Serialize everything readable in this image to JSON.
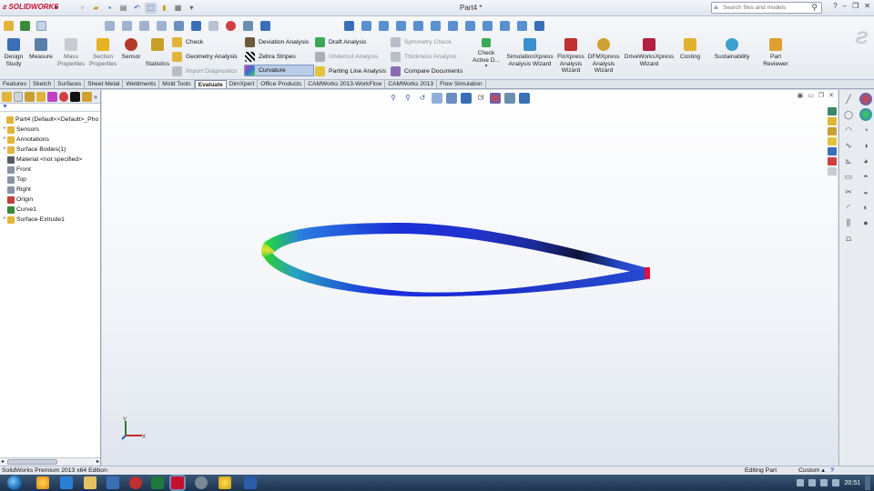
{
  "app": {
    "logo": "SOLIDWORKS",
    "document_title": "Part4 *"
  },
  "search": {
    "placeholder": "Search files and models"
  },
  "evaluate_toolbar": {
    "big_buttons": [
      {
        "label": "Design Study",
        "icon": "design-study-icon",
        "color": "#3a6fb8"
      },
      {
        "label": "Measure",
        "icon": "measure-icon",
        "color": "#5a7fa8"
      },
      {
        "label": "Mass Properties",
        "icon": "mass-properties-icon",
        "color": "#c9cbd0"
      },
      {
        "label": "Section Properties",
        "icon": "section-properties-icon",
        "color": "#e6b422"
      },
      {
        "label": "Sensor",
        "icon": "sensor-icon",
        "color": "#b43b2a"
      },
      {
        "label": "Statistics",
        "icon": "statistics-icon",
        "color": "#c8a028"
      }
    ],
    "column1": [
      {
        "label": "Check",
        "icon": "check-icon",
        "color": "#e2b43a",
        "disabled": false
      },
      {
        "label": "Geometry Analysis",
        "icon": "geometry-analysis-icon",
        "color": "#e2b43a",
        "disabled": false
      },
      {
        "label": "Import Diagnostics",
        "icon": "import-diagnostics-icon",
        "color": "#b8bec8",
        "disabled": true
      }
    ],
    "column2": [
      {
        "label": "Deviation Analysis",
        "icon": "deviation-analysis-icon",
        "color": "#6b5b3a",
        "disabled": false
      },
      {
        "label": "Zebra Stripes",
        "icon": "zebra-stripes-icon",
        "color": "#222222",
        "disabled": false
      },
      {
        "label": "Curvature",
        "icon": "curvature-icon",
        "color": "#d43aa8",
        "disabled": false,
        "active": true
      }
    ],
    "column3": [
      {
        "label": "Draft Analysis",
        "icon": "draft-analysis-icon",
        "color": "#3aa856",
        "disabled": false
      },
      {
        "label": "Undercut Analysis",
        "icon": "undercut-analysis-icon",
        "color": "#a8b0bc",
        "disabled": true
      },
      {
        "label": "Parting Line Analysis",
        "icon": "parting-line-analysis-icon",
        "color": "#e2c43a",
        "disabled": false
      }
    ],
    "column4": [
      {
        "label": "Symmetry Check",
        "icon": "symmetry-check-icon",
        "color": "#b8bec8",
        "disabled": true
      },
      {
        "label": "Thickness Analysis",
        "icon": "thickness-analysis-icon",
        "color": "#b8bec8",
        "disabled": true
      },
      {
        "label": "Compare Documents",
        "icon": "compare-documents-icon",
        "color": "#8a6bb0",
        "disabled": false
      }
    ],
    "check_active": {
      "label": "Check Active D...",
      "icon": "check-active-document-icon",
      "color": "#3aa856"
    },
    "wizards": [
      {
        "label": "SimulationXpress Analysis Wizard",
        "icon": "simulationxpress-icon",
        "color": "#3a8fd0"
      },
      {
        "label": "FloXpress Analysis Wizard",
        "icon": "floxpress-icon",
        "color": "#c03030"
      },
      {
        "label": "DFMXpress Analysis Wizard",
        "icon": "dfmxpress-icon",
        "color": "#d0a030"
      },
      {
        "label": "DriveWorksXpress Wizard",
        "icon": "driveworksxpress-icon",
        "color": "#b02040"
      },
      {
        "label": "Costing",
        "icon": "costing-icon",
        "color": "#e0b030"
      },
      {
        "label": "Sustainability",
        "icon": "sustainability-icon",
        "color": "#3aa0d0"
      },
      {
        "label": "Part Reviewer",
        "icon": "part-reviewer-icon",
        "color": "#e0a030"
      }
    ]
  },
  "tabs": [
    {
      "label": "Features",
      "active": false
    },
    {
      "label": "Sketch",
      "active": false
    },
    {
      "label": "Surfaces",
      "active": false
    },
    {
      "label": "Sheet Metal",
      "active": false
    },
    {
      "label": "Weldments",
      "active": false
    },
    {
      "label": "Mold Tools",
      "active": false
    },
    {
      "label": "Evaluate",
      "active": true
    },
    {
      "label": "DimXpert",
      "active": false
    },
    {
      "label": "Office Products",
      "active": false
    },
    {
      "label": "CAMWorks 2013-WorkFlow",
      "active": false
    },
    {
      "label": "CAMWorks 2013",
      "active": false
    },
    {
      "label": "Flow Simulation",
      "active": false
    }
  ],
  "feature_tree": {
    "nodes": [
      {
        "label": "Part4  (Default<<Default>_Pho",
        "icon": "part-icon",
        "color": "#e2b43a",
        "expander": "",
        "indent": 0
      },
      {
        "label": "Sensors",
        "icon": "sensors-icon",
        "color": "#e2b43a",
        "expander": "+",
        "indent": 1
      },
      {
        "label": "Annotations",
        "icon": "annotations-icon",
        "color": "#e2b43a",
        "expander": "+",
        "indent": 1
      },
      {
        "label": "Surface Bodies(1)",
        "icon": "surface-bodies-icon",
        "color": "#e2b43a",
        "expander": "+",
        "indent": 1
      },
      {
        "label": "Material <not specified>",
        "icon": "material-icon",
        "color": "#555b66",
        "expander": "",
        "indent": 1
      },
      {
        "label": "Front",
        "icon": "plane-icon",
        "color": "#8a93a3",
        "expander": "",
        "indent": 1
      },
      {
        "label": "Top",
        "icon": "plane-icon",
        "color": "#8a93a3",
        "expander": "",
        "indent": 1
      },
      {
        "label": "Right",
        "icon": "plane-icon",
        "color": "#8a93a3",
        "expander": "",
        "indent": 1
      },
      {
        "label": "Origin",
        "icon": "origin-icon",
        "color": "#c04040",
        "expander": "",
        "indent": 1
      },
      {
        "label": "Curve1",
        "icon": "curve-icon",
        "color": "#3a8a3a",
        "expander": "",
        "indent": 1
      },
      {
        "label": "Surface-Extrude1",
        "icon": "surface-extrude-icon",
        "color": "#e2b43a",
        "expander": "+",
        "indent": 1
      }
    ]
  },
  "status_bar": {
    "product": "SolidWorks Premium 2013 x64 Edition",
    "mode": "Editing Part",
    "units": "Custom"
  },
  "taskbar": {
    "clock": "20:51"
  }
}
